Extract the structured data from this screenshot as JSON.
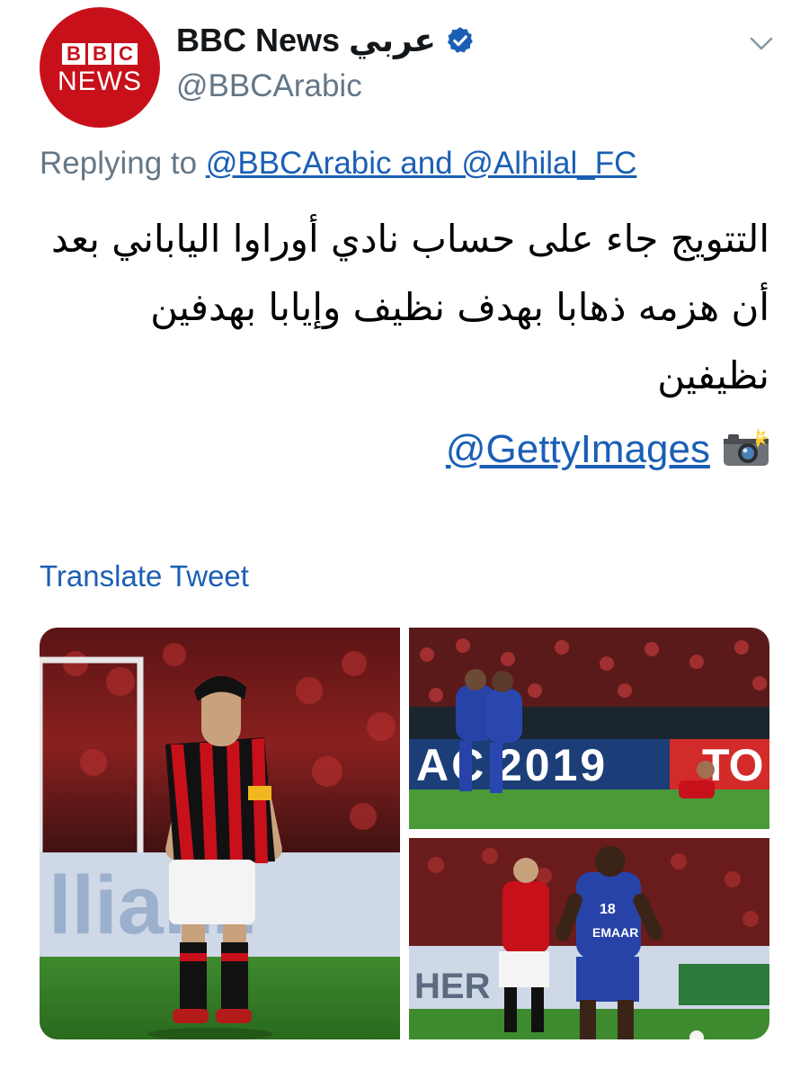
{
  "account": {
    "display_name": "BBC News عربي",
    "handle": "@BBCArabic",
    "avatar_letters": [
      "B",
      "B",
      "C"
    ],
    "avatar_word": "NEWS",
    "brand_color": "#c8101b",
    "verified_icon": "verified-badge-icon"
  },
  "reply": {
    "prefix": "Replying to ",
    "mentions": "@BBCArabic and @Alhilal_FC"
  },
  "tweet": {
    "text": "التتويج جاء على حساب نادي أوراوا الياباني بعد أن هزمه ذهابا بهدف نظيف وإيابا بهدفين نظيفين",
    "credit_link": "@GettyImages",
    "credit_icon": "📸"
  },
  "translate_label": "Translate Tweet",
  "photos": {
    "banner_year": "2019",
    "banner_prefix": "AC",
    "sign_text": "TO",
    "board_left": "llianz",
    "board_right": "HER",
    "jersey_number": "18",
    "sponsor": "EMAAR"
  },
  "colors": {
    "link": "#1b5fb5",
    "muted": "#657786",
    "verified": "#1da1f2"
  }
}
